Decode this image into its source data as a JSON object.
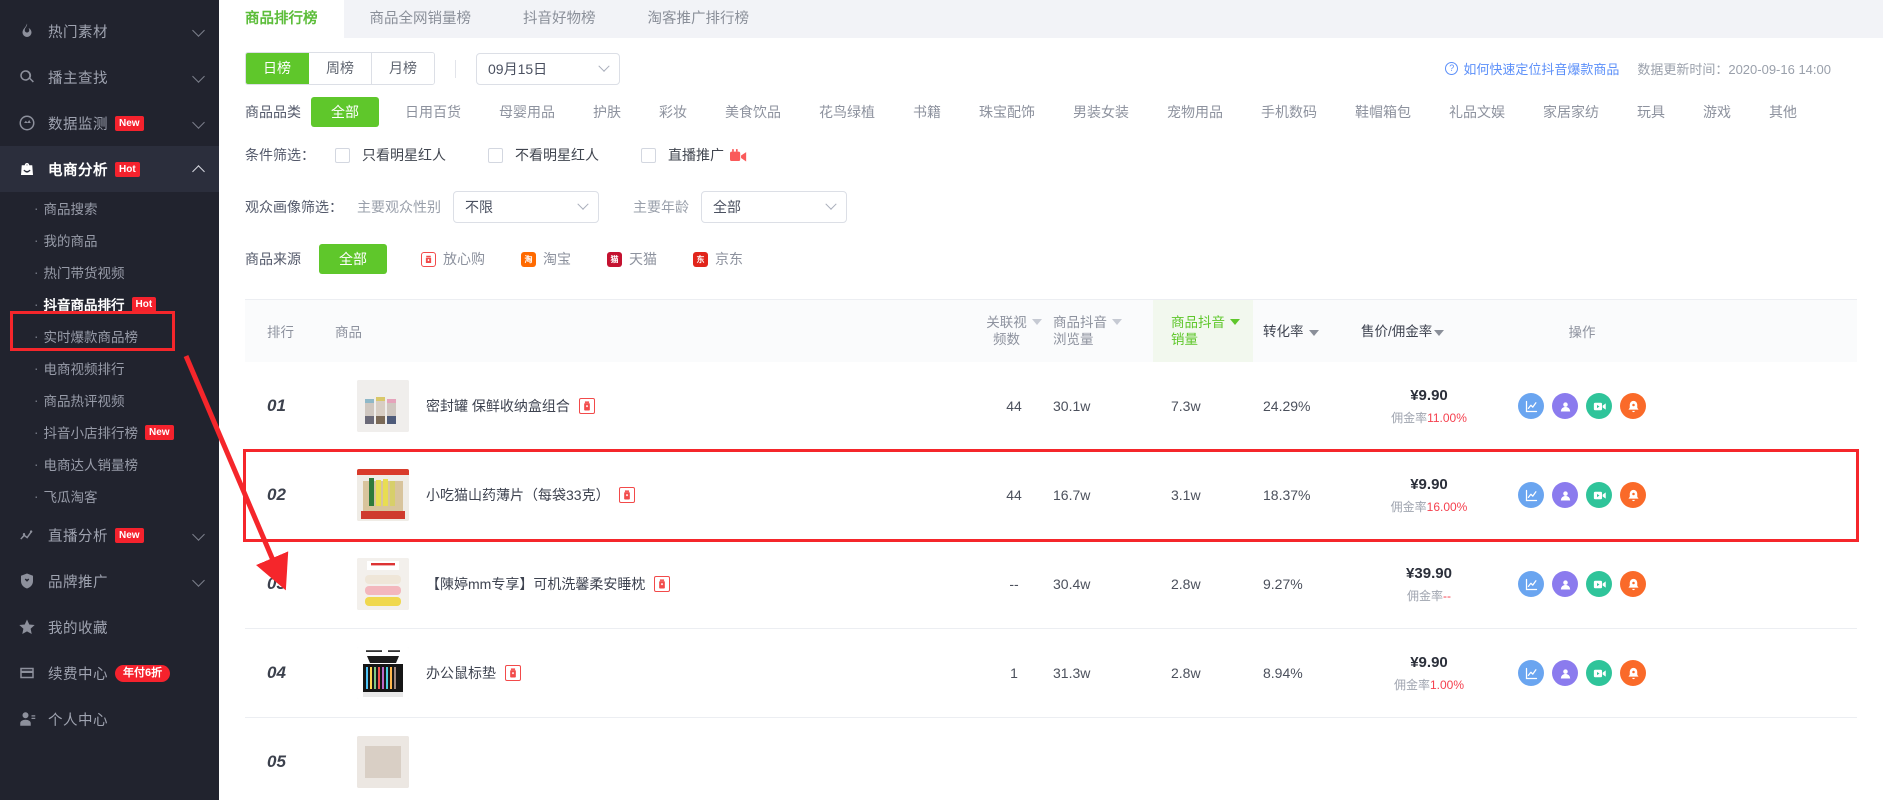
{
  "sidebar": {
    "groups": [
      {
        "icon": "fire-icon",
        "label": "热门素材",
        "badge": null,
        "expanded": false,
        "chevron": "down"
      },
      {
        "icon": "search-icon",
        "label": "播主查找",
        "badge": null,
        "expanded": false,
        "chevron": "down"
      },
      {
        "icon": "monitor-icon",
        "label": "数据监测",
        "badge": "New",
        "expanded": false,
        "chevron": "down"
      },
      {
        "icon": "bag-icon",
        "label": "电商分析",
        "badge": "Hot",
        "expanded": true,
        "chevron": "up"
      }
    ],
    "ecommerce_items": [
      {
        "label": "商品搜索",
        "badge": null,
        "active": false
      },
      {
        "label": "我的商品",
        "badge": null,
        "active": false
      },
      {
        "label": "热门带货视频",
        "badge": null,
        "active": false
      },
      {
        "label": "抖音商品排行",
        "badge": "Hot",
        "active": true
      },
      {
        "label": "实时爆款商品榜",
        "badge": null,
        "active": false
      },
      {
        "label": "电商视频排行",
        "badge": null,
        "active": false
      },
      {
        "label": "商品热评视频",
        "badge": null,
        "active": false
      },
      {
        "label": "抖音小店排行榜",
        "badge": "New",
        "active": false
      },
      {
        "label": "电商达人销量榜",
        "badge": null,
        "active": false
      },
      {
        "label": "飞瓜淘客",
        "badge": null,
        "active": false
      }
    ],
    "bottom_groups": [
      {
        "icon": "chart-line-icon",
        "label": "直播分析",
        "badge": "New",
        "chevron": "down"
      },
      {
        "icon": "shield-icon",
        "label": "品牌推广",
        "badge": null,
        "chevron": "down"
      },
      {
        "icon": "star-icon",
        "label": "我的收藏",
        "badge": null,
        "chevron": null
      },
      {
        "icon": "card-icon",
        "label": "续费中心",
        "badge": "年付6折",
        "chevron": null
      },
      {
        "icon": "user-icon",
        "label": "个人中心",
        "badge": null,
        "chevron": null
      }
    ]
  },
  "tabs": [
    {
      "label": "商品排行榜",
      "active": true
    },
    {
      "label": "商品全网销量榜",
      "active": false
    },
    {
      "label": "抖音好物榜",
      "active": false
    },
    {
      "label": "淘客推广排行榜",
      "active": false
    }
  ],
  "toolbar": {
    "periods": [
      {
        "label": "日榜",
        "active": true
      },
      {
        "label": "周榜",
        "active": false
      },
      {
        "label": "月榜",
        "active": false
      }
    ],
    "date_value": "09月15日",
    "help_link": "如何快速定位抖音爆款商品",
    "update_label": "数据更新时间：",
    "update_time": "2020-09-16 14:00"
  },
  "filters": {
    "category_label": "商品品类",
    "categories": [
      {
        "label": "全部",
        "active": true
      },
      {
        "label": "日用百货",
        "active": false
      },
      {
        "label": "母婴用品",
        "active": false
      },
      {
        "label": "护肤",
        "active": false
      },
      {
        "label": "彩妆",
        "active": false
      },
      {
        "label": "美食饮品",
        "active": false
      },
      {
        "label": "花鸟绿植",
        "active": false
      },
      {
        "label": "书籍",
        "active": false
      },
      {
        "label": "珠宝配饰",
        "active": false
      },
      {
        "label": "男装女装",
        "active": false
      },
      {
        "label": "宠物用品",
        "active": false
      },
      {
        "label": "手机数码",
        "active": false
      },
      {
        "label": "鞋帽箱包",
        "active": false
      },
      {
        "label": "礼品文娱",
        "active": false
      },
      {
        "label": "家居家纺",
        "active": false
      },
      {
        "label": "玩具",
        "active": false
      },
      {
        "label": "游戏",
        "active": false
      },
      {
        "label": "其他",
        "active": false
      }
    ],
    "condition_label": "条件筛选：",
    "conditions": [
      {
        "label": "只看明星红人",
        "checked": false,
        "icon": null
      },
      {
        "label": "不看明星红人",
        "checked": false,
        "icon": null
      },
      {
        "label": "直播推广",
        "checked": false,
        "icon": "live-camera-icon"
      }
    ],
    "audience_label": "观众画像筛选：",
    "audience_gender_label": "主要观众性别",
    "audience_gender_value": "不限",
    "audience_age_label": "主要年龄",
    "audience_age_value": "全部",
    "source_label": "商品来源",
    "sources": [
      {
        "label": "全部",
        "active": true,
        "icon": null,
        "color": "#5fc72b"
      },
      {
        "label": "放心购",
        "active": false,
        "icon": "fangxingou-icon",
        "color": "#f24a4a"
      },
      {
        "label": "淘宝",
        "active": false,
        "icon": "taobao-icon",
        "color": "#ff6a00"
      },
      {
        "label": "天猫",
        "active": false,
        "icon": "tmall-icon",
        "color": "#c41230"
      },
      {
        "label": "京东",
        "active": false,
        "icon": "jd-icon",
        "color": "#e1251b"
      }
    ]
  },
  "table": {
    "columns": [
      {
        "key": "rank",
        "label": "排行",
        "sortable": false,
        "sorted": false
      },
      {
        "key": "product",
        "label": "商品",
        "sortable": false,
        "sorted": false
      },
      {
        "key": "videos",
        "label": "关联视\n频数",
        "label_l1": "关联视",
        "label_l2": "频数",
        "sortable": true,
        "sorted": false
      },
      {
        "key": "views",
        "label_l1": "商品抖音",
        "label_l2": "浏览量",
        "sortable": true,
        "sorted": false
      },
      {
        "key": "sales",
        "label_l1": "商品抖音",
        "label_l2": "销量",
        "sortable": true,
        "sorted": true
      },
      {
        "key": "conversion",
        "label": "转化率",
        "sortable": true,
        "sorted": false,
        "dark": true
      },
      {
        "key": "price",
        "label": "售价/佣金率",
        "sortable": true,
        "sorted": false,
        "dark": true
      },
      {
        "key": "ops",
        "label": "操作",
        "sortable": false,
        "sorted": false
      }
    ],
    "commission_prefix": "佣金率",
    "rows": [
      {
        "rank": "01",
        "name": "密封罐 保鲜收纳盒组合",
        "source_icon": "fangxingou-icon",
        "videos": "44",
        "views": "30.1w",
        "sales": "7.3w",
        "conversion": "24.29%",
        "price": "¥9.90",
        "commission": "11.00%",
        "highlighted": false
      },
      {
        "rank": "02",
        "name": "小吃猫山药薄片（每袋33克）",
        "source_icon": "fangxingou-icon",
        "videos": "44",
        "views": "16.7w",
        "sales": "3.1w",
        "conversion": "18.37%",
        "price": "¥9.90",
        "commission": "16.00%",
        "highlighted": true
      },
      {
        "rank": "03",
        "name": "【陳婷mm专享】可机洗馨柔安睡枕",
        "source_icon": "fangxingou-icon",
        "videos": "--",
        "views": "30.4w",
        "sales": "2.8w",
        "conversion": "9.27%",
        "price": "¥39.90",
        "commission": "--",
        "highlighted": false
      },
      {
        "rank": "04",
        "name": "办公鼠标垫",
        "source_icon": "fangxingou-icon",
        "videos": "1",
        "views": "31.3w",
        "sales": "2.8w",
        "conversion": "8.94%",
        "price": "¥9.90",
        "commission": "1.00%",
        "highlighted": false
      },
      {
        "rank": "05",
        "name": "",
        "source_icon": "fangxingou-icon",
        "videos": "",
        "views": "",
        "sales": "",
        "conversion": "",
        "price": "",
        "commission": "",
        "highlighted": false
      }
    ],
    "operations": [
      {
        "name": "trend-chart-icon",
        "color": "#6aa5f0"
      },
      {
        "name": "user-profile-icon",
        "color": "#8b7bee"
      },
      {
        "name": "video-play-icon",
        "color": "#2fc49a"
      },
      {
        "name": "alarm-icon",
        "color": "#fa6a29"
      }
    ]
  },
  "colors": {
    "accent_green": "#5fc72b",
    "highlight_red": "#f5262b",
    "link_blue": "#5b8ff9",
    "sidebar_bg": "#21232e"
  }
}
